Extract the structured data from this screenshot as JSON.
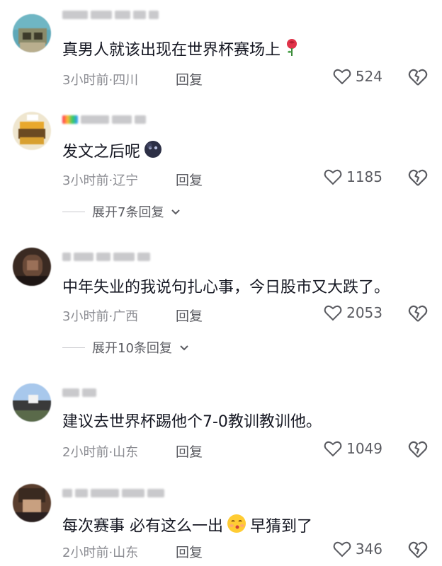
{
  "comments": [
    {
      "text": "真男人就该出现在世界杯赛场上",
      "emoji": "rose-icon",
      "time_location": "3小时前·四川",
      "reply_label": "回复",
      "likes": "524"
    },
    {
      "text": "发文之后呢",
      "emoji": "dark-face-icon",
      "time_location": "3小时前·辽宁",
      "reply_label": "回复",
      "likes": "1185",
      "expand_label": "展开7条回复"
    },
    {
      "text": "中年失业的我说句扎心事，今日股市又大跌了。",
      "time_location": "3小时前·广西",
      "reply_label": "回复",
      "likes": "2053",
      "expand_label": "展开10条回复"
    },
    {
      "text": "建议去世界杯踢他个7-0教训教训他。",
      "time_location": "2小时前·山东",
      "reply_label": "回复",
      "likes": "1049"
    },
    {
      "text": "每次赛事 必有这么一出",
      "text_after_emoji": "早猜到了",
      "emoji": "kissing-face-icon",
      "time_location": "2小时前·山东",
      "reply_label": "回复",
      "likes": "346"
    }
  ],
  "colors": {
    "text": "#161823",
    "meta": "#8a8b91",
    "action": "#5a5b61"
  }
}
